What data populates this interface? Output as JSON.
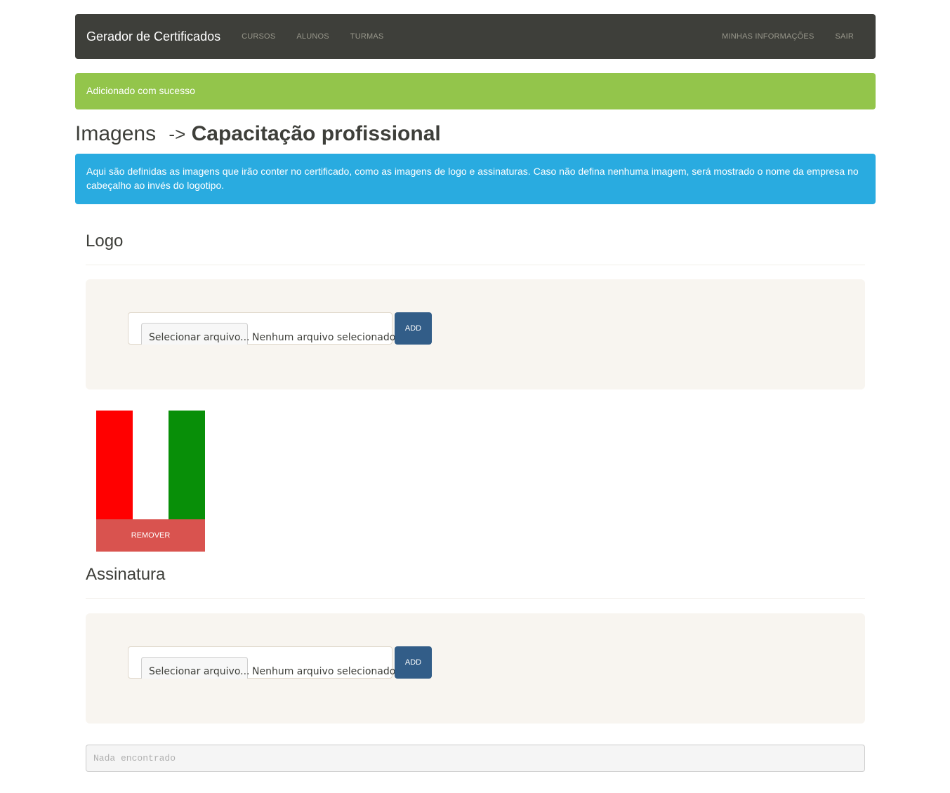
{
  "navbar": {
    "brand": "Gerador de Certificados",
    "left_links": [
      "CURSOS",
      "ALUNOS",
      "TURMAS"
    ],
    "right_links": [
      "MINHAS INFORMAÇÕES",
      "SAIR"
    ],
    "background": "#3e3f3a"
  },
  "alert_success": {
    "text": "Adicionado com sucesso",
    "color": "#93c54b"
  },
  "heading": {
    "prefix": "Imagens",
    "arrow": "->",
    "course": "Capacitação profissional"
  },
  "alert_info": {
    "text": "Aqui são definidas as imagens que irão conter no certificado, como as imagens de logo e assinaturas. Caso não defina nenhuma imagem, será mostrado o nome da empresa no cabeçalho ao invés do logotipo.",
    "color": "#29abe0"
  },
  "logo_section": {
    "title": "Logo",
    "file_button": "Selecionar arquivo...",
    "file_status": "Nenhum arquivo selecionado.",
    "add_label": "ADD",
    "image": {
      "stripe_colors": [
        "#ff0000",
        "#ffffff",
        "#088f08"
      ],
      "remove_label": "REMOVER"
    }
  },
  "signature_section": {
    "title": "Assinatura",
    "file_button": "Selecionar arquivo...",
    "file_status": "Nenhum arquivo selecionado.",
    "add_label": "ADD"
  },
  "empty_state": {
    "text": "Nada encontrado"
  }
}
